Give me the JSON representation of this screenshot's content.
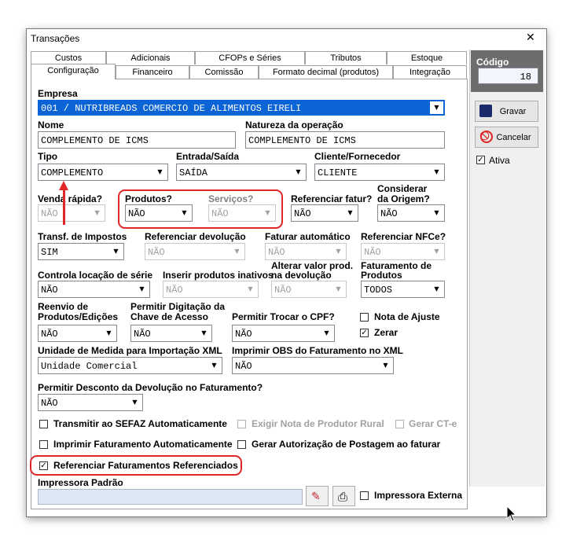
{
  "window": {
    "title": "Transações",
    "close": "✕"
  },
  "tabs_row1": [
    "Custos",
    "Adicionais",
    "CFOPs e Séries",
    "Tributos",
    "Estoque"
  ],
  "tabs_row2": [
    "Configuração",
    "Financeiro",
    "Comissão",
    "Formato decimal (produtos)",
    "Integração"
  ],
  "side": {
    "codigo_label": "Código",
    "codigo_value": "18",
    "gravar": "Gravar",
    "cancelar": "Cancelar",
    "ativa": "Ativa"
  },
  "fields": {
    "empresa_label": "Empresa",
    "empresa_value": "001 / NUTRIBREADS COMERCIO DE ALIMENTOS EIRELI",
    "nome_label": "Nome",
    "nome_value": "COMPLEMENTO DE ICMS",
    "natureza_label": "Natureza da operação",
    "natureza_value": "COMPLEMENTO DE ICMS",
    "tipo_label": "Tipo",
    "tipo_value": "COMPLEMENTO",
    "entrada_label": "Entrada/Saída",
    "entrada_value": "SAÍDA",
    "cliente_label": "Cliente/Fornecedor",
    "cliente_value": "CLIENTE",
    "venda_label": "Venda rápida?",
    "venda_value": "NÃO",
    "produtos_label": "Produtos?",
    "produtos_value": "NÃO",
    "servicos_label": "Serviços?",
    "servicos_value": "NÃO",
    "refaturar_label": "Referenciar fatur?",
    "refaturar_value": "NÃO",
    "origem_label1": "Considerar",
    "origem_label2": "da Origem?",
    "origem_value": "NÃO",
    "transf_label": "Transf. de Impostos",
    "transf_value": "SIM",
    "refdev_label": "Referenciar devolução",
    "refdev_value": "NÃO",
    "fatauto_label": "Faturar automático",
    "fatauto_value": "NÃO",
    "refnfce_label": "Referenciar NFCe?",
    "refnfce_value": "NÃO",
    "locacao_label": "Controla locação de série",
    "locacao_value": "NÃO",
    "inativos_label": "Inserir produtos inativos",
    "inativos_value": "NÃO",
    "alterar_label1": "Alterar valor prod.",
    "alterar_label2": "na devolução",
    "alterar_value": "NÃO",
    "fatprod_label1": "Faturamento de",
    "fatprod_label2": "Produtos",
    "fatprod_value": "TODOS",
    "reenvio_label1": "Reenvio de",
    "reenvio_label2": "Produtos/Edições",
    "reenvio_value": "NÃO",
    "digit_label1": "Permitir Digitação da",
    "digit_label2": "Chave de Acesso",
    "digit_value": "NÃO",
    "cpf_label": "Permitir Trocar o CPF?",
    "cpf_value": "NÃO",
    "nota_ajuste": "Nota de Ajuste",
    "zerar": "Zerar",
    "unidade_label": "Unidade de Medida para Importação XML",
    "unidade_value": "Unidade Comercial",
    "obs_label": "Imprimir OBS do Faturamento no XML",
    "obs_value": "NÃO",
    "desconto_label": "Permitir Desconto da Devolução no Faturamento?",
    "desconto_value": "NÃO",
    "impressora_label": "Impressora Padrão",
    "impressora_value": ""
  },
  "checks": {
    "sefaz": "Transmitir ao SEFAZ Automaticamente",
    "rural": "Exigir Nota de Produtor Rural",
    "cte": "Gerar CT-e",
    "imprimir": "Imprimir Faturamento Automaticamente",
    "postagem": "Gerar Autorização de Postagem ao faturar",
    "referenciar": "Referenciar Faturamentos Referenciados",
    "externa": "Impressora Externa"
  },
  "colors": {
    "accent": "#0a64d6",
    "highlight": "#e02626",
    "side_header": "#6d6d6d"
  }
}
